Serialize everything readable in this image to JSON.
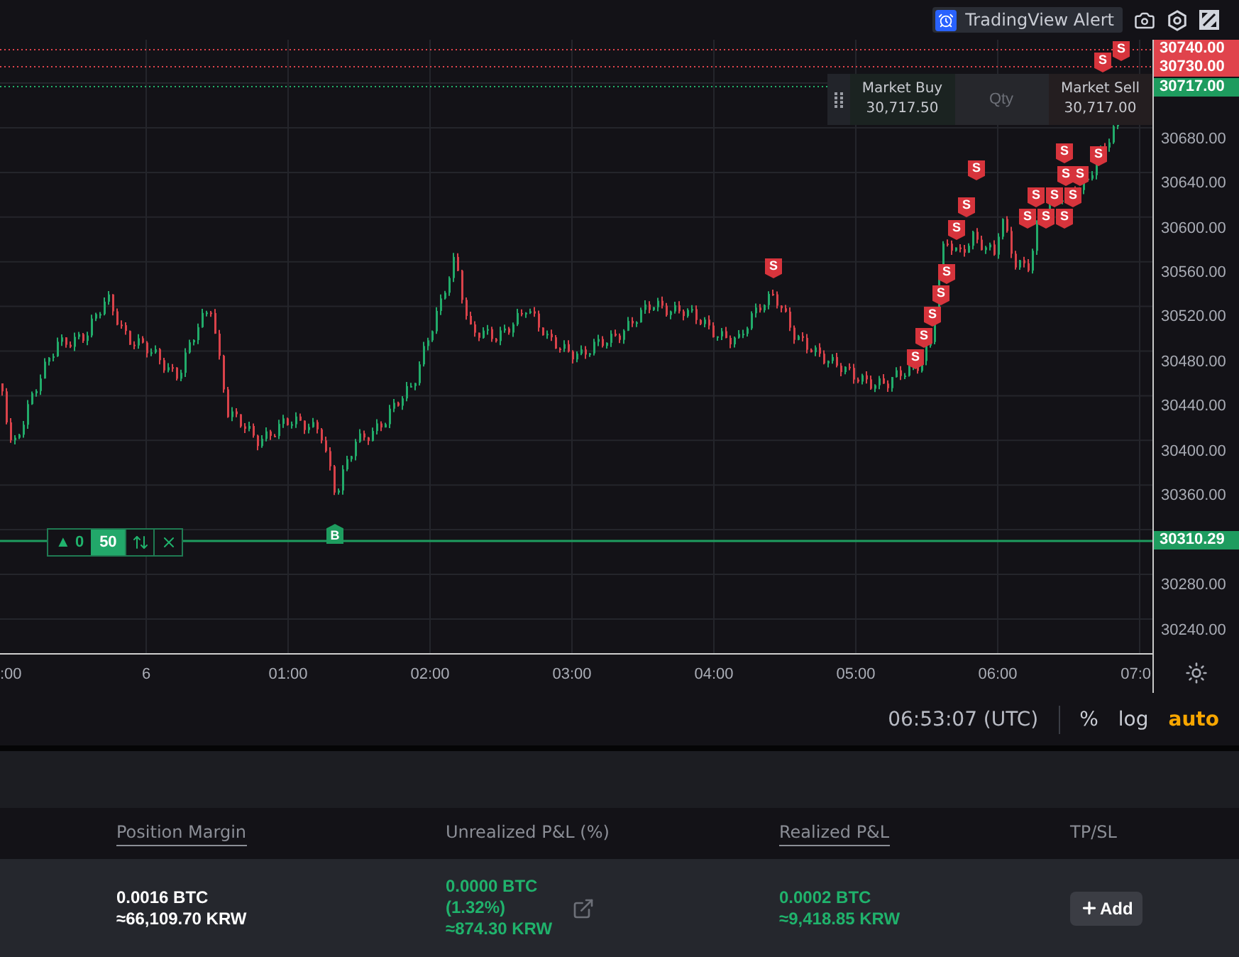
{
  "toolbar": {
    "alert_button": "TradingView Alert"
  },
  "order_panel": {
    "buy_label": "Market Buy",
    "buy_price": "30,717.50",
    "qty_placeholder": "Qty",
    "sell_label": "Market Sell",
    "sell_price": "30,717.00"
  },
  "price_axis": {
    "ticks": [
      "30680.00",
      "30640.00",
      "30600.00",
      "30560.00",
      "30520.00",
      "30480.00",
      "30440.00",
      "30400.00",
      "30360.00",
      "30280.00",
      "30240.00"
    ],
    "tags": [
      {
        "label": "30740.00",
        "kind": "sell"
      },
      {
        "label": "30730.00",
        "kind": "sell"
      },
      {
        "label": "30717.00",
        "kind": "buy"
      },
      {
        "label": "30310.29",
        "kind": "position"
      }
    ]
  },
  "time_axis": {
    "ticks": [
      ":00",
      "6",
      "01:00",
      "02:00",
      "03:00",
      "04:00",
      "05:00",
      "06:00",
      "07:0"
    ]
  },
  "position_line": {
    "side_label": "▲ 0",
    "quantity": "50"
  },
  "markers": [
    {
      "label": "B",
      "kind": "buy"
    },
    {
      "label": "S",
      "kind": "sell"
    },
    {
      "label": "S",
      "kind": "sell"
    },
    {
      "label": "S",
      "kind": "sell"
    },
    {
      "label": "S",
      "kind": "sell"
    },
    {
      "label": "S",
      "kind": "sell"
    },
    {
      "label": "S",
      "kind": "sell"
    },
    {
      "label": "S",
      "kind": "sell"
    },
    {
      "label": "S",
      "kind": "sell"
    },
    {
      "label": "S",
      "kind": "sell"
    },
    {
      "label": "S",
      "kind": "sell"
    },
    {
      "label": "S",
      "kind": "sell"
    },
    {
      "label": "S",
      "kind": "sell"
    },
    {
      "label": "S",
      "kind": "sell"
    },
    {
      "label": "S",
      "kind": "sell"
    },
    {
      "label": "S",
      "kind": "sell"
    },
    {
      "label": "S",
      "kind": "sell"
    },
    {
      "label": "S",
      "kind": "sell"
    },
    {
      "label": "S",
      "kind": "sell"
    },
    {
      "label": "S",
      "kind": "sell"
    },
    {
      "label": "S",
      "kind": "sell"
    },
    {
      "label": "S",
      "kind": "sell"
    }
  ],
  "status_bar": {
    "time": "06:53:07 (UTC)",
    "options": [
      {
        "label": "%",
        "selected": false
      },
      {
        "label": "log",
        "selected": false
      },
      {
        "label": "auto",
        "selected": true
      }
    ]
  },
  "positions": {
    "columns": [
      {
        "label": "Position Margin",
        "underlined": true
      },
      {
        "label": "Unrealized P&L (%)",
        "underlined": false
      },
      {
        "label": "Realized P&L",
        "underlined": true
      },
      {
        "label": "TP/SL",
        "underlined": false
      }
    ],
    "rows": [
      {
        "margin": [
          "0.0016 BTC",
          "≈66,109.70 KRW"
        ],
        "unrealized": [
          "0.0000 BTC",
          "(1.32%)",
          "≈874.30 KRW"
        ],
        "realized": [
          "0.0002 BTC",
          "≈9,418.85 KRW"
        ],
        "tpsl_button": "Add"
      }
    ]
  }
}
